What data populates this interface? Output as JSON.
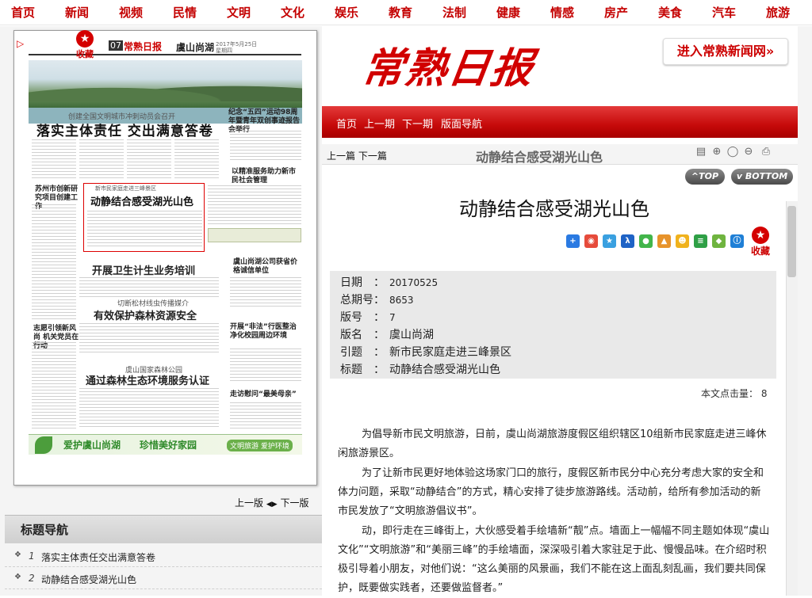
{
  "top_nav": [
    "首页",
    "新闻",
    "视频",
    "民情",
    "文明",
    "文化",
    "娱乐",
    "教育",
    "法制",
    "健康",
    "情感",
    "房产",
    "美食",
    "汽车",
    "旅游"
  ],
  "colors": {
    "brand_red": "#c40000",
    "nav_bar_red": "#c60a0a",
    "meta_bg": "#e9e9e9"
  },
  "paper_preview": {
    "favorite_label": "收藏",
    "page_number": "07",
    "brand": "常熟日报",
    "section": "虞山尚湖",
    "date_line": "2017年5月25日 星期四",
    "kicker_1": "创建全国文明城市冲刺动员会召开",
    "headline_1": "落实主体责任 交出满意答卷",
    "side_head_1": "纪念“五四”运动98周年暨青年双创事迹报告会举行",
    "side_head_2": "苏州市创新研究项目创建工作",
    "side_head_3": "以精准服务助力新市民社会管理",
    "highlight_kicker": "新市民家庭走进三峰景区",
    "highlight_title": "动静结合感受湖光山色",
    "headline_2": "开展卫生计生业务培训",
    "side_head_4": "虞山尚湖公司获省价格诚信单位",
    "kicker_3": "切断松材线虫传播媒介",
    "headline_3": "有效保护森林资源安全",
    "side_head_5": "志愿引领新风尚 机关党员在行动",
    "side_head_6": "开展“非法”行医整治 净化校园周边环境",
    "kicker_4": "虞山国家森林公园",
    "headline_4": "通过森林生态环境服务认证",
    "side_head_7": "走访慰问“最美母亲”",
    "banner_1": "爱护虞山尚湖",
    "banner_2": "珍惜美好家园",
    "banner_3": "文明旅游 爱护环境"
  },
  "pager": {
    "prev": "上一版",
    "next": "下一版"
  },
  "topic_nav": {
    "title": "标题导航",
    "items": [
      {
        "num": "1",
        "label": "落实主体责任交出满意答卷"
      },
      {
        "num": "2",
        "label": "动静结合感受湖光山色"
      }
    ]
  },
  "header": {
    "logo": "常熟日报",
    "enter_button": "进入常熟新闻网»"
  },
  "red_nav": [
    "首页",
    "上一期",
    "下一期",
    "版面导航"
  ],
  "article_bar": {
    "prev": "上一篇",
    "next": "下一篇",
    "title": "动静结合感受湖光山色"
  },
  "toolbar_icons": [
    "note-icon",
    "zoom-in-icon",
    "zoom-reset-icon",
    "zoom-out-icon",
    "print-icon"
  ],
  "scroll_buttons": {
    "top": "TOP",
    "bottom": "BOTTOM"
  },
  "article": {
    "title": "动静结合感受湖光山色",
    "favorite_label": "收藏",
    "meta": [
      {
        "key": "日期",
        "value": "20170525"
      },
      {
        "key": "总期号",
        "value": "8653"
      },
      {
        "key": "版号",
        "value": "7"
      },
      {
        "key": "版名",
        "value": "虞山尚湖"
      },
      {
        "key": "引题",
        "value": "新市民家庭走进三峰景区"
      },
      {
        "key": "标题",
        "value": "动静结合感受湖光山色"
      }
    ],
    "hits_label": "本文点击量：",
    "hits": "8",
    "paragraphs": [
      "为倡导新市民文明旅游，日前，虞山尚湖旅游度假区组织辖区10组新市民家庭走进三峰休闲旅游景区。",
      "为了让新市民更好地体验这场家门口的旅行，度假区新市民分中心充分考虑大家的安全和体力问题，采取“动静结合”的方式，精心安排了徒步旅游路线。活动前，给所有参加活动的新市民发放了“文明旅游倡议书”。",
      "动，即行走在三峰街上，大伙感受着手绘墙新“靓”点。墙面上一幅幅不同主题如体现“虞山文化”“文明旅游”和“美丽三峰”的手绘墙面，深深吸引着大家驻足于此、慢慢品味。在介绍时积极引导着小朋友，对他们说：“这么美丽的风景画，我们不能在这上面乱刻乱画，我们要共同保护，既要做实践者，还要做监督者。”"
    ]
  },
  "share_icons": [
    "plus-share-icon",
    "weibo-icon",
    "qzone-icon",
    "renren-icon",
    "wechat-icon",
    "tencent-icon",
    "kaixin-icon",
    "douban-icon",
    "sohu-icon",
    "more-share-icon"
  ]
}
